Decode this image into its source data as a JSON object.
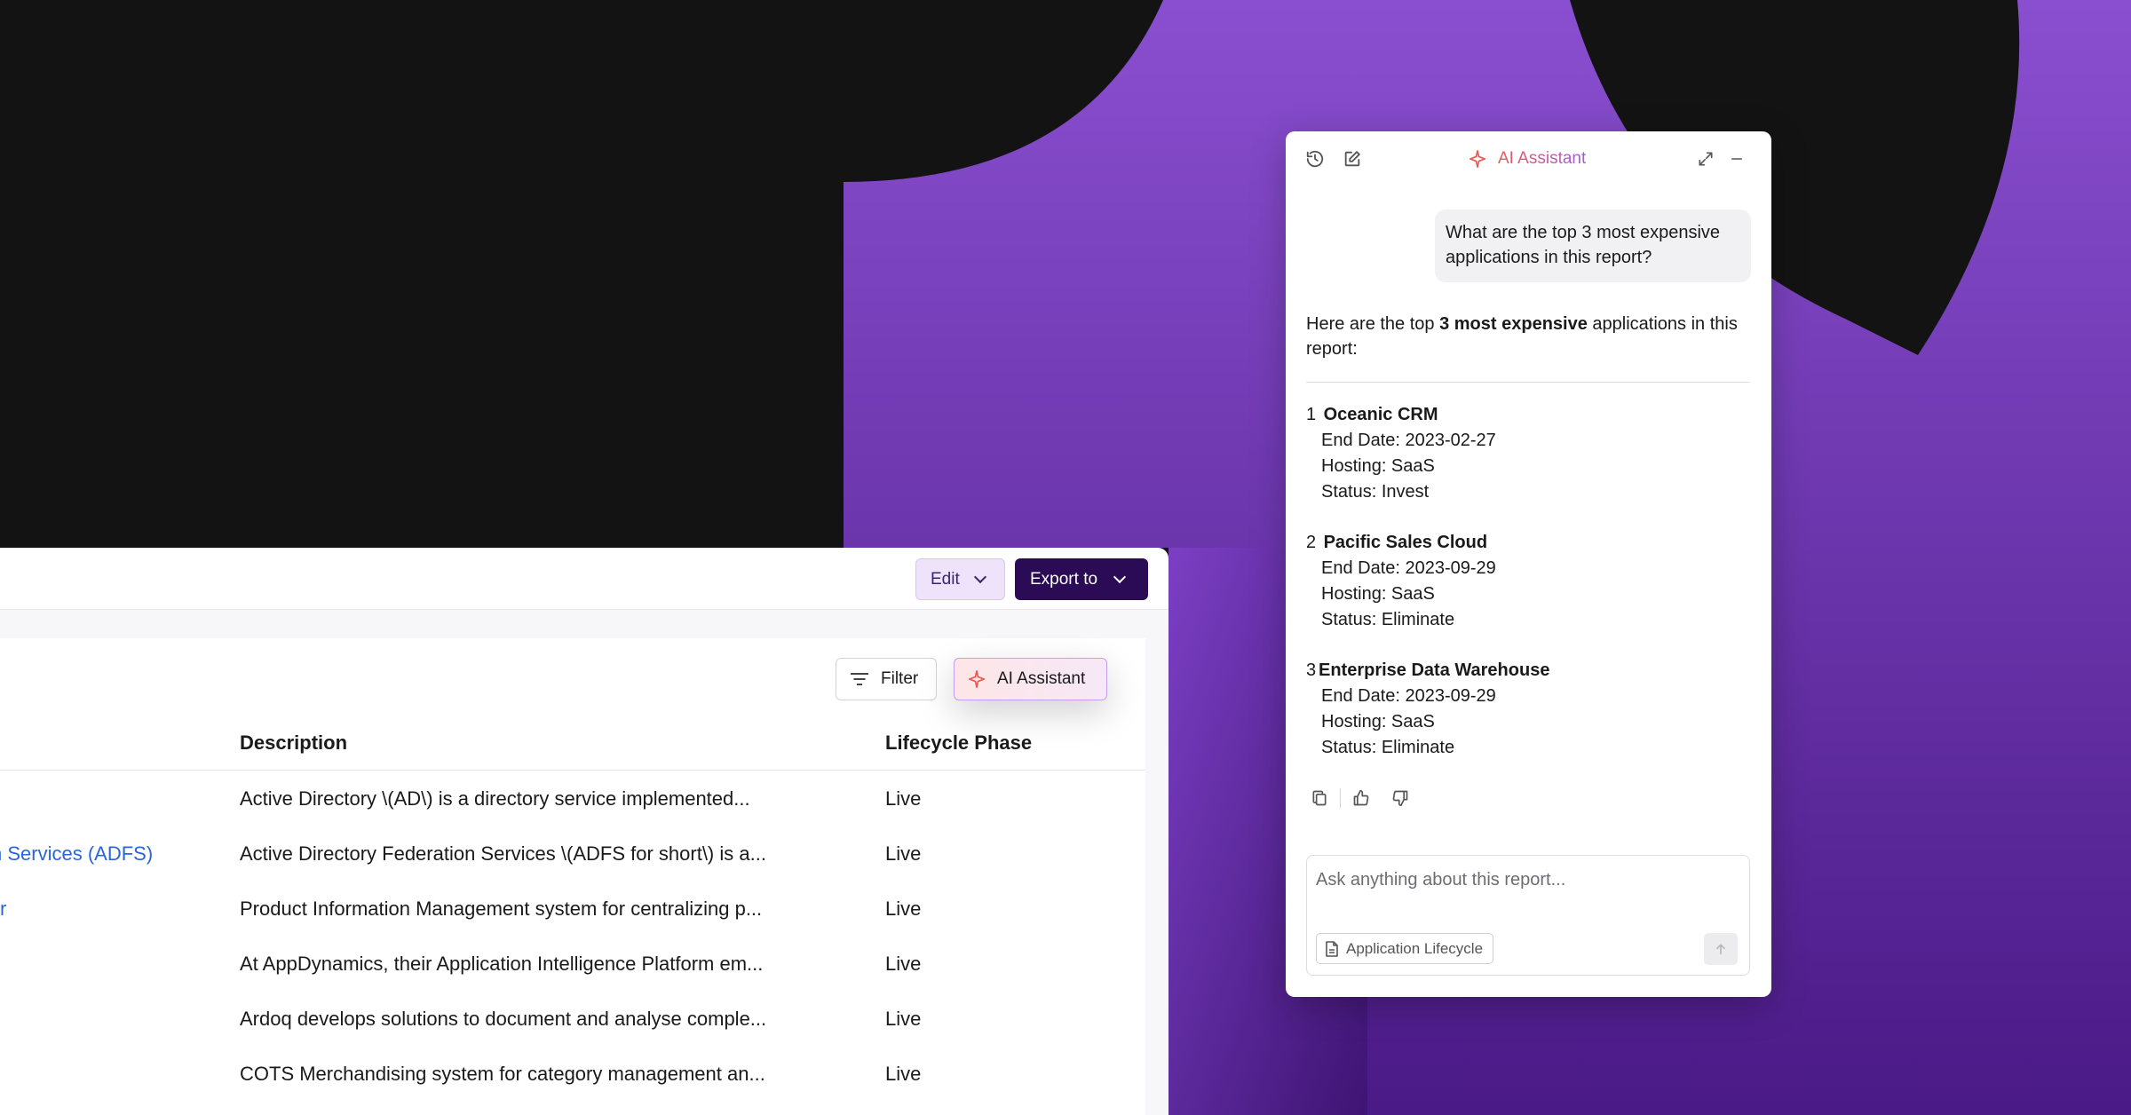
{
  "report": {
    "toolbar": {
      "edit_label": "Edit",
      "export_label": "Export to"
    },
    "controls": {
      "filter_label": "Filter",
      "ai_assistant_label": "AI Assistant"
    },
    "columns": {
      "description": "Description",
      "lifecycle": "Lifecycle Phase"
    },
    "rows": [
      {
        "name": "",
        "description": "Active Directory \\(AD\\) is a directory service implemented...",
        "phase": "Live"
      },
      {
        "name": "n Services (ADFS)",
        "description": "Active Directory Federation Services \\(ADFS for short\\) is a...",
        "phase": "Live"
      },
      {
        "name": "r",
        "description": "Product Information Management system for centralizing p...",
        "phase": "Live"
      },
      {
        "name": "",
        "description": "At AppDynamics, their Application Intelligence Platform em...",
        "phase": "Live"
      },
      {
        "name": "",
        "description": "Ardoq develops solutions to document and analyse comple...",
        "phase": "Live"
      },
      {
        "name": "",
        "description": "COTS Merchandising system for category management an...",
        "phase": "Live"
      }
    ]
  },
  "assistant": {
    "title": "AI Assistant",
    "user_message": "What are the top 3 most expensive applications in this report?",
    "reply_prefix": "Here are the top ",
    "reply_bold": "3 most expensive",
    "reply_suffix": " applications in this report:",
    "items": [
      {
        "num": "1",
        "name": "Oceanic CRM",
        "end_date": "End Date: 2023-02-27",
        "hosting": "Hosting: SaaS",
        "status": "Status: Invest"
      },
      {
        "num": "2",
        "name": "Pacific Sales Cloud",
        "end_date": "End Date: 2023-09-29",
        "hosting": "Hosting: SaaS",
        "status": "Status: Eliminate"
      },
      {
        "num": "3",
        "name": "Enterprise Data Warehouse",
        "end_date": "End Date: 2023-09-29",
        "hosting": "Hosting: SaaS",
        "status": "Status: Eliminate"
      }
    ],
    "input_placeholder": "Ask anything about this report...",
    "context_chip": "Application Lifecycle"
  },
  "colors": {
    "brand_dark": "#2b0a56",
    "purple": "#6a2fb0",
    "link": "#2a66d9"
  }
}
